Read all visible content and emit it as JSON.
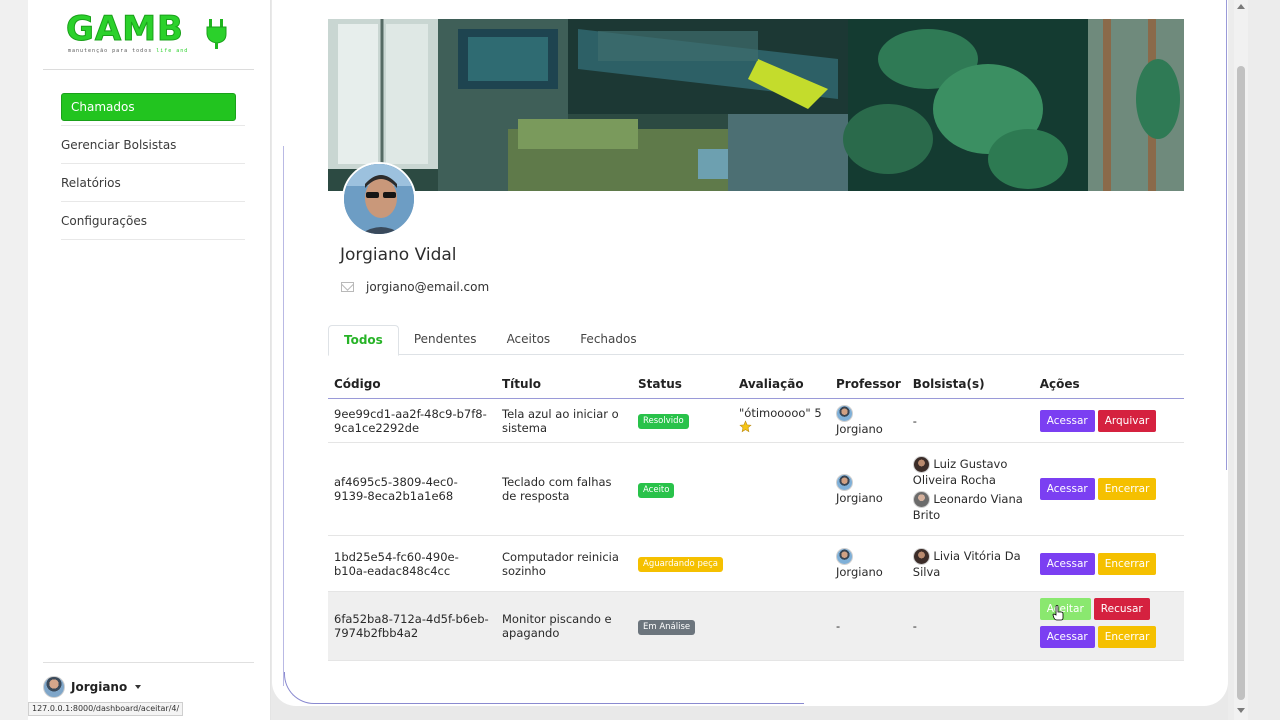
{
  "app": {
    "logo_text": "GAMB",
    "logo_tagline": "manutenção para todos",
    "logo_tagline_suffix": "life and"
  },
  "sidebar": {
    "items": [
      {
        "label": "Chamados",
        "active": true
      },
      {
        "label": "Gerenciar Bolsistas",
        "active": false
      },
      {
        "label": "Relatórios",
        "active": false
      },
      {
        "label": "Configurações",
        "active": false
      }
    ],
    "user": {
      "name": "Jorgiano"
    }
  },
  "status_bar": {
    "url": "127.0.0.1:8000/dashboard/aceitar/4/"
  },
  "profile": {
    "name": "Jorgiano Vidal",
    "email": "jorgiano@email.com"
  },
  "tabs": [
    {
      "label": "Todos",
      "active": true
    },
    {
      "label": "Pendentes",
      "active": false
    },
    {
      "label": "Aceitos",
      "active": false
    },
    {
      "label": "Fechados",
      "active": false
    }
  ],
  "table": {
    "headers": [
      "Código",
      "Título",
      "Status",
      "Avaliação",
      "Professor",
      "Bolsista(s)",
      "Ações"
    ],
    "rows": [
      {
        "codigo": "9ee99cd1-aa2f-48c9-b7f8-9ca1ce2292de",
        "titulo": "Tela azul ao iniciar o sistema",
        "status": "Resolvido",
        "avaliacao": "\"ótimooooo\" 5",
        "professor": "Jorgiano",
        "bolsistas": [
          "-"
        ],
        "actions": [
          "Acessar",
          "Arquivar"
        ]
      },
      {
        "codigo": "af4695c5-3809-4ec0-9139-8eca2b1a1e68",
        "titulo": "Teclado com falhas de resposta",
        "status": "Aceito",
        "avaliacao": "",
        "professor": "Jorgiano",
        "bolsistas": [
          "Luiz Gustavo Oliveira Rocha",
          "Leonardo Viana Brito"
        ],
        "actions": [
          "Acessar",
          "Encerrar"
        ]
      },
      {
        "codigo": "1bd25e54-fc60-490e-b10a-eadac848c4cc",
        "titulo": "Computador reinicia sozinho",
        "status": "Aguardando peça",
        "avaliacao": "",
        "professor": "Jorgiano",
        "bolsistas": [
          "Livia Vitória Da Silva"
        ],
        "actions": [
          "Acessar",
          "Encerrar"
        ]
      },
      {
        "codigo": "6fa52ba8-712a-4d5f-b6eb-7974b2fbb4a2",
        "titulo": "Monitor piscando e apagando",
        "status": "Em Análise",
        "avaliacao": "",
        "professor": "-",
        "bolsistas": [
          "-"
        ],
        "actions": [
          "Aceitar",
          "Recusar",
          "Acessar",
          "Encerrar"
        ]
      }
    ]
  },
  "colors": {
    "brand_green": "#22c41f",
    "status_resolvido": "#29c24a",
    "status_aceito": "#29c24a",
    "status_aguardando": "#f5c000",
    "status_analise": "#6c757d",
    "btn_acessar": "#7b3ff2",
    "btn_danger": "#d5213f",
    "btn_warning": "#f5c000",
    "btn_accept_hover": "#8ae86f"
  }
}
